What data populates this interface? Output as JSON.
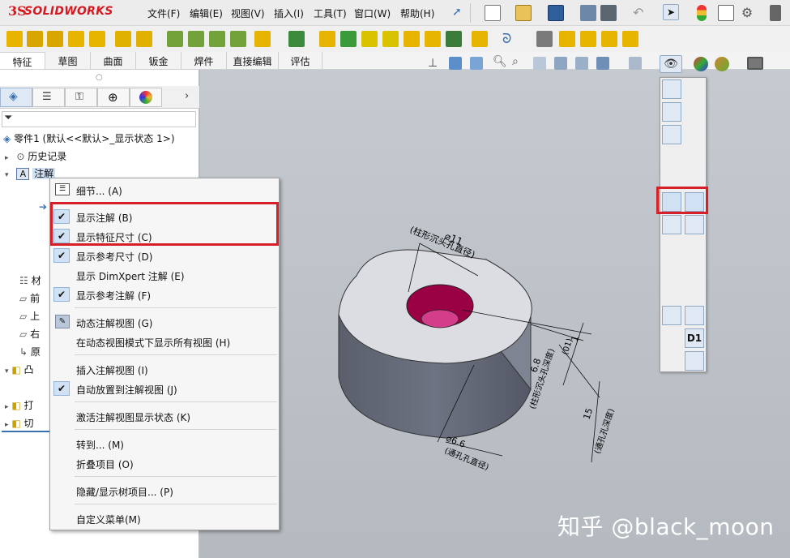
{
  "app": {
    "logo_brand": "SOLIDWORKS",
    "logo_prefix": "3S"
  },
  "menubar": {
    "items": [
      "文件(F)",
      "编辑(E)",
      "视图(V)",
      "插入(I)",
      "工具(T)",
      "窗口(W)",
      "帮助(H)"
    ]
  },
  "command_tabs": [
    "特征",
    "草图",
    "曲面",
    "钣金",
    "焊件",
    "直接编辑",
    "评估"
  ],
  "tree": {
    "root": "零件1  (默认<<默认>_显示状态 1>)",
    "history": "历史记录",
    "annotations": "注解",
    "truncated_rows": [
      "材",
      "前",
      "上",
      "右",
      "原",
      "凸",
      "打",
      "切"
    ]
  },
  "context_menu": {
    "items": [
      {
        "label": "细节... (A)",
        "checked": false,
        "icon": "details-icon"
      },
      {
        "label": "显示注解 (B)",
        "checked": true
      },
      {
        "label": "显示特征尺寸 (C)",
        "checked": true
      },
      {
        "label": "显示参考尺寸 (D)",
        "checked": true
      },
      {
        "label": "显示 DimXpert 注解 (E)",
        "checked": false
      },
      {
        "label": "显示参考注解 (F)",
        "checked": true
      },
      {
        "label": "动态注解视图 (G)",
        "checked": false,
        "icon": "dynamic-view-icon"
      },
      {
        "label": "在动态视图模式下显示所有视图 (H)",
        "checked": false
      },
      {
        "label": "插入注解视图 (I)",
        "checked": false
      },
      {
        "label": "自动放置到注解视图 (J)",
        "checked": true
      },
      {
        "label": "激活注解视图显示状态 (K)",
        "checked": false
      },
      {
        "label": "转到... (M)",
        "checked": false
      },
      {
        "label": "折叠项目 (O)",
        "checked": false
      },
      {
        "label": "隐藏/显示树项目... (P)",
        "checked": false
      },
      {
        "label": "自定义菜单(M)",
        "checked": false
      }
    ]
  },
  "model_annotations": {
    "top_dim": "⌀11",
    "top_dim_note": "(柱形沉头孔直径)",
    "right_dim_1": "1",
    "right_dim_1_note": "(01)",
    "right_dim_2": "6.8",
    "right_dim_2_note": "(柱形沉头孔深度)",
    "right_dim_3": "15",
    "right_dim_3_note": "(通孔孔深度)",
    "bottom_dim": "⌀6.6",
    "bottom_dim_note": "(通孔孔直径)"
  },
  "flyout": {
    "d1_label": "D1"
  },
  "watermark": "知乎 @black_moon",
  "colors": {
    "highlight_red": "#d71f27",
    "brand_red": "#d51920",
    "hole_magenta": "#b0004f"
  }
}
